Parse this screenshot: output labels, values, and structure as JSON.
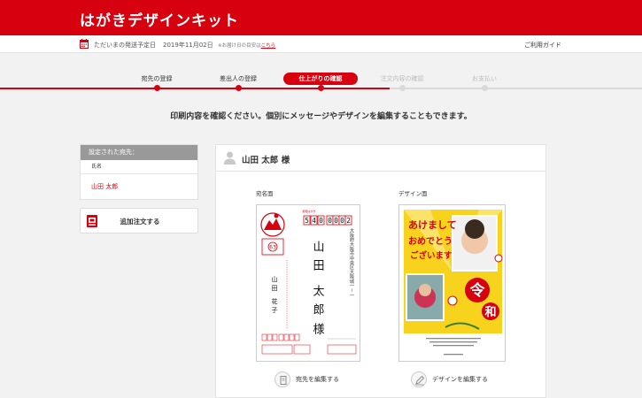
{
  "header": {
    "logo": "はがきデザインキット"
  },
  "infobar": {
    "ship_label": "ただいまの発送予定日",
    "ship_date": "2019年11月02日",
    "ship_note_prefix": "※お届け日の目安は",
    "ship_note_link": "こちら",
    "guide": "ご利用ガイド"
  },
  "steps": [
    {
      "label": "宛先の登録",
      "state": "done"
    },
    {
      "label": "差出人の登録",
      "state": "done"
    },
    {
      "label": "仕上がりの確認",
      "state": "active"
    },
    {
      "label": "注文内容の確認",
      "state": "todo"
    },
    {
      "label": "お支払い",
      "state": "todo"
    }
  ],
  "instruction": "印刷内容を確認ください。個別にメッセージやデザインを編集することもできます。",
  "sidebar": {
    "header": "設定された宛先：",
    "column": "氏名",
    "rows": [
      "山田 太郎"
    ],
    "add_order": "追加注文する"
  },
  "main": {
    "recipient": "山田 太郎 様",
    "addr_label": "宛名面",
    "design_label": "デザイン面",
    "edit_addr": "宛先を編集する",
    "edit_design": "デザインを編集する"
  },
  "postcard": {
    "postal_code": [
      "5",
      "4",
      "0",
      "0",
      "0",
      "0",
      "2"
    ],
    "address": "大阪府大阪市中央区大阪城一－一",
    "recipient_family": "山田",
    "recipient_given": "太郎",
    "honorific": "様",
    "sender_family": "山田",
    "sender_given": "花子",
    "stamp_price": "63",
    "design_greeting": "あけましておめでとうございます",
    "design_era": "令和"
  },
  "colors": {
    "brand": "#d7000f",
    "inactive": "#d9d9d9"
  }
}
